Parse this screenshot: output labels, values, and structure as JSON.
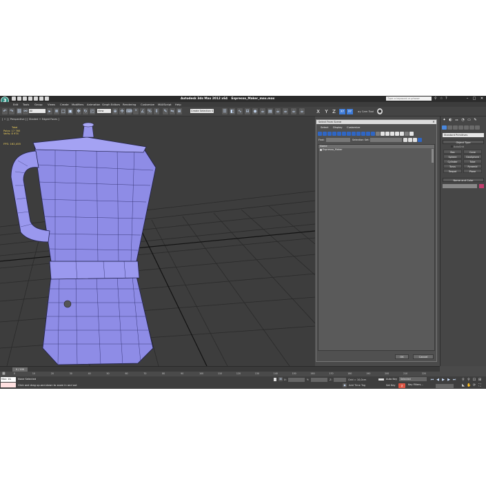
{
  "titlebar": {
    "logo": "3",
    "app_name": "Autodesk 3ds Max  2012 x64",
    "file_name": "Espresso_Maker_max.max",
    "search_placeholder": "Type a keyword or phrase",
    "minimize": "–",
    "maximize": "□",
    "close": "✕"
  },
  "menu": [
    "Edit",
    "Tools",
    "Group",
    "Views",
    "Create",
    "Modifiers",
    "Animation",
    "Graph Editors",
    "Rendering",
    "Customize",
    "MAXScript",
    "Help"
  ],
  "toolbar": {
    "selection_filter": "All",
    "reference_coord": "View",
    "named_selection": "Create Selection S",
    "axis_x": "X",
    "axis_y": "Y",
    "axis_z": "Z",
    "axis_xy": "XY",
    "axis_xy2": "XY",
    "camera_tool": "ay Cam Tool"
  },
  "viewport": {
    "label": "[ + ] [ Perspective ] [ Shaded + Edged Faces ]",
    "stats_header": "Total",
    "polys_label": "Polys:",
    "polys_value": "17 760",
    "verts_label": "Verts:",
    "verts_value": "8 974",
    "fps_label": "FPS:",
    "fps_value": "162,455",
    "accent_color": "#8f8ee8"
  },
  "dialog": {
    "title": "Select From Scene",
    "menu": [
      "Select",
      "Display",
      "Customize"
    ],
    "find_label": "Find:",
    "selection_set_label": "Selection Set:",
    "column_header": "Name",
    "rows": [
      "Espresso_Maker"
    ],
    "ok": "OK",
    "cancel": "Cancel"
  },
  "command_panel": {
    "dropdown": "Standard Primitives",
    "object_type_title": "Object Type",
    "autogrid": "AutoGrid",
    "primitives": [
      "Box",
      "Cone",
      "Sphere",
      "GeoSphere",
      "Cylinder",
      "Tube",
      "Torus",
      "Pyramid",
      "Teapot",
      "Plane"
    ],
    "name_color_title": "Name and Color",
    "color_swatch": "#c13e6e"
  },
  "timeline": {
    "slider": "0 / 100",
    "ticks": [
      "0",
      "5",
      "10",
      "15",
      "20",
      "25",
      "30",
      "35",
      "40",
      "45",
      "50",
      "55",
      "60",
      "65",
      "70",
      "75",
      "80",
      "85",
      "90",
      "95",
      "100",
      "105",
      "110",
      "115",
      "120",
      "125",
      "130",
      "135",
      "140",
      "145",
      "150",
      "155",
      "160",
      "165",
      "170",
      "175",
      "180",
      "185",
      "190",
      "195",
      "200",
      "205",
      "210",
      "215",
      "220"
    ]
  },
  "status": {
    "maxscript": "Max: 1&",
    "line1": "None Selected",
    "line2": "Click and drag up-and-down to zoom in and out",
    "x_label": "X:",
    "y_label": "Y:",
    "z_label": "Z:",
    "grid": "Grid = 10,0cm",
    "add_time_tag": "Add Time Tag",
    "auto_key": "Auto Key",
    "set_key": "Set Key",
    "key_select": "Selected",
    "key_filters": "Key Filters..."
  }
}
